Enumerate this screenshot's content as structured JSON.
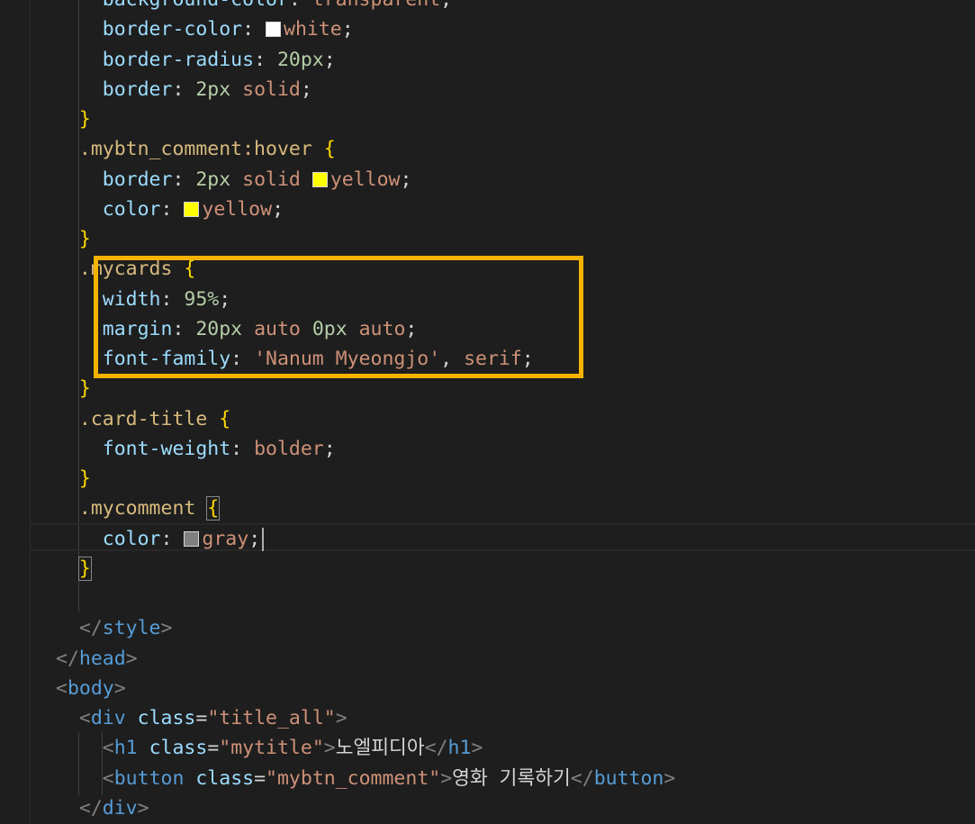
{
  "editor": {
    "lines": [
      {
        "indent": "    ",
        "segments": [
          {
            "t": "background-color",
            "c": "prop"
          },
          {
            "t": ": ",
            "c": "punc"
          },
          {
            "t": "transparent",
            "c": "val"
          },
          {
            "t": ";",
            "c": "punc"
          }
        ]
      },
      {
        "indent": "    ",
        "segments": [
          {
            "t": "border-color",
            "c": "prop"
          },
          {
            "t": ": ",
            "c": "punc"
          },
          {
            "swatch": "#ffffff"
          },
          {
            "t": "white",
            "c": "val"
          },
          {
            "t": ";",
            "c": "punc"
          }
        ]
      },
      {
        "indent": "    ",
        "segments": [
          {
            "t": "border-radius",
            "c": "prop"
          },
          {
            "t": ": ",
            "c": "punc"
          },
          {
            "t": "20px",
            "c": "num"
          },
          {
            "t": ";",
            "c": "punc"
          }
        ]
      },
      {
        "indent": "    ",
        "segments": [
          {
            "t": "border",
            "c": "prop"
          },
          {
            "t": ": ",
            "c": "punc"
          },
          {
            "t": "2px",
            "c": "num"
          },
          {
            "t": " ",
            "c": "punc"
          },
          {
            "t": "solid",
            "c": "val"
          },
          {
            "t": ";",
            "c": "punc"
          }
        ]
      },
      {
        "indent": "  ",
        "segments": [
          {
            "t": "}",
            "c": "brace"
          }
        ]
      },
      {
        "indent": "  ",
        "segments": [
          {
            "t": ".mybtn_comment:hover",
            "c": "sel"
          },
          {
            "t": " ",
            "c": "punc"
          },
          {
            "t": "{",
            "c": "brace"
          }
        ]
      },
      {
        "indent": "    ",
        "segments": [
          {
            "t": "border",
            "c": "prop"
          },
          {
            "t": ": ",
            "c": "punc"
          },
          {
            "t": "2px",
            "c": "num"
          },
          {
            "t": " ",
            "c": "punc"
          },
          {
            "t": "solid",
            "c": "val"
          },
          {
            "t": " ",
            "c": "punc"
          },
          {
            "swatch": "#ffff00"
          },
          {
            "t": "yellow",
            "c": "val"
          },
          {
            "t": ";",
            "c": "punc"
          }
        ]
      },
      {
        "indent": "    ",
        "segments": [
          {
            "t": "color",
            "c": "prop"
          },
          {
            "t": ": ",
            "c": "punc"
          },
          {
            "swatch": "#ffff00"
          },
          {
            "t": "yellow",
            "c": "val"
          },
          {
            "t": ";",
            "c": "punc"
          }
        ]
      },
      {
        "indent": "  ",
        "segments": [
          {
            "t": "}",
            "c": "brace"
          }
        ]
      },
      {
        "indent": "  ",
        "segments": [
          {
            "t": ".mycards",
            "c": "sel"
          },
          {
            "t": " ",
            "c": "punc"
          },
          {
            "t": "{",
            "c": "brace"
          }
        ]
      },
      {
        "indent": "    ",
        "segments": [
          {
            "t": "width",
            "c": "prop"
          },
          {
            "t": ": ",
            "c": "punc"
          },
          {
            "t": "95%",
            "c": "num"
          },
          {
            "t": ";",
            "c": "punc"
          }
        ]
      },
      {
        "indent": "    ",
        "segments": [
          {
            "t": "margin",
            "c": "prop"
          },
          {
            "t": ": ",
            "c": "punc"
          },
          {
            "t": "20px",
            "c": "num"
          },
          {
            "t": " ",
            "c": "punc"
          },
          {
            "t": "auto",
            "c": "val"
          },
          {
            "t": " ",
            "c": "punc"
          },
          {
            "t": "0px",
            "c": "num"
          },
          {
            "t": " ",
            "c": "punc"
          },
          {
            "t": "auto",
            "c": "val"
          },
          {
            "t": ";",
            "c": "punc"
          }
        ]
      },
      {
        "indent": "    ",
        "segments": [
          {
            "t": "font-family",
            "c": "prop"
          },
          {
            "t": ": ",
            "c": "punc"
          },
          {
            "t": "'Nanum Myeongjo'",
            "c": "val"
          },
          {
            "t": ", ",
            "c": "punc"
          },
          {
            "t": "serif",
            "c": "val"
          },
          {
            "t": ";",
            "c": "punc"
          }
        ]
      },
      {
        "indent": "  ",
        "segments": [
          {
            "t": "}",
            "c": "brace"
          }
        ]
      },
      {
        "indent": "  ",
        "segments": [
          {
            "t": ".card-title",
            "c": "sel"
          },
          {
            "t": " ",
            "c": "punc"
          },
          {
            "t": "{",
            "c": "brace"
          }
        ]
      },
      {
        "indent": "    ",
        "segments": [
          {
            "t": "font-weight",
            "c": "prop"
          },
          {
            "t": ": ",
            "c": "punc"
          },
          {
            "t": "bolder",
            "c": "val"
          },
          {
            "t": ";",
            "c": "punc"
          }
        ]
      },
      {
        "indent": "  ",
        "segments": [
          {
            "t": "}",
            "c": "brace"
          }
        ]
      },
      {
        "indent": "  ",
        "segments": [
          {
            "t": ".mycomment",
            "c": "sel"
          },
          {
            "t": " ",
            "c": "punc"
          },
          {
            "t": "{",
            "c": "brace",
            "bm": true
          }
        ]
      },
      {
        "indent": "    ",
        "cursor": true,
        "segments": [
          {
            "t": "color",
            "c": "prop"
          },
          {
            "t": ": ",
            "c": "punc"
          },
          {
            "swatch": "#808080"
          },
          {
            "t": "gray",
            "c": "val"
          },
          {
            "t": ";",
            "c": "punc"
          }
        ]
      },
      {
        "indent": "  ",
        "segments": [
          {
            "t": "}",
            "c": "brace",
            "bm": true
          }
        ]
      },
      {
        "indent": "",
        "segments": []
      },
      {
        "indent": "  ",
        "segments": [
          {
            "t": "</",
            "c": "tagp"
          },
          {
            "t": "style",
            "c": "tag"
          },
          {
            "t": ">",
            "c": "tagp"
          }
        ]
      },
      {
        "indent": "",
        "segments": [
          {
            "t": "</",
            "c": "tagp"
          },
          {
            "t": "head",
            "c": "tag"
          },
          {
            "t": ">",
            "c": "tagp"
          }
        ]
      },
      {
        "indent": "",
        "segments": [
          {
            "t": "<",
            "c": "tagp"
          },
          {
            "t": "body",
            "c": "tag"
          },
          {
            "t": ">",
            "c": "tagp"
          }
        ]
      },
      {
        "indent": "  ",
        "segments": [
          {
            "t": "<",
            "c": "tagp"
          },
          {
            "t": "div",
            "c": "tag"
          },
          {
            "t": " ",
            "c": "punc"
          },
          {
            "t": "class",
            "c": "attr"
          },
          {
            "t": "=",
            "c": "punc"
          },
          {
            "t": "\"title_all\"",
            "c": "str"
          },
          {
            "t": ">",
            "c": "tagp"
          }
        ]
      },
      {
        "indent": "    ",
        "segments": [
          {
            "t": "<",
            "c": "tagp"
          },
          {
            "t": "h1",
            "c": "tag"
          },
          {
            "t": " ",
            "c": "punc"
          },
          {
            "t": "class",
            "c": "attr"
          },
          {
            "t": "=",
            "c": "punc"
          },
          {
            "t": "\"mytitle\"",
            "c": "str"
          },
          {
            "t": ">",
            "c": "tagp"
          },
          {
            "t": "노엘피디아",
            "c": "txt"
          },
          {
            "t": "</",
            "c": "tagp"
          },
          {
            "t": "h1",
            "c": "tag"
          },
          {
            "t": ">",
            "c": "tagp"
          }
        ]
      },
      {
        "indent": "    ",
        "segments": [
          {
            "t": "<",
            "c": "tagp"
          },
          {
            "t": "button",
            "c": "tag"
          },
          {
            "t": " ",
            "c": "punc"
          },
          {
            "t": "class",
            "c": "attr"
          },
          {
            "t": "=",
            "c": "punc"
          },
          {
            "t": "\"mybtn_comment\"",
            "c": "str"
          },
          {
            "t": ">",
            "c": "tagp"
          },
          {
            "t": "영화 기록하기",
            "c": "txt"
          },
          {
            "t": "</",
            "c": "tagp"
          },
          {
            "t": "button",
            "c": "tag"
          },
          {
            "t": ">",
            "c": "tagp"
          }
        ]
      },
      {
        "indent": "  ",
        "segments": [
          {
            "t": "</",
            "c": "tagp"
          },
          {
            "t": "div",
            "c": "tag"
          },
          {
            "t": ">",
            "c": "tagp"
          }
        ]
      }
    ]
  },
  "colors": {
    "background": "#1e1e1e",
    "highlight_box": "#f5b300"
  }
}
